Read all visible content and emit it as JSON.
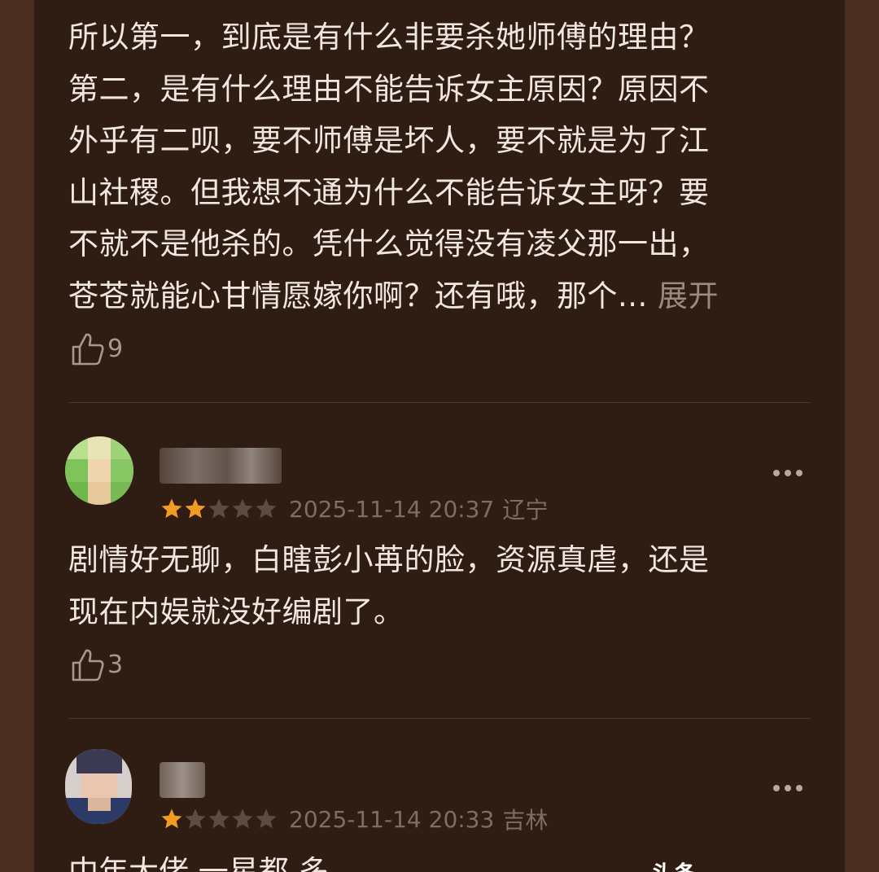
{
  "comments": [
    {
      "lines": [
        "所以第一，到底是有什么非要杀她师傅的理由？",
        "第二，是有什么理由不能告诉女主原因？原因不",
        "外乎有二呗，要不师傅是坏人，要不就是为了江",
        "山社稷。但我想不通为什么不能告诉女主呀？要",
        "不就不是他杀的。凭什么觉得没有凌父那一出，",
        "苍苍就能心甘情愿嫁你啊？还有哦，那个... "
      ],
      "expand_label": "展开",
      "likes": "9"
    },
    {
      "rating": 2,
      "time": "2025-11-14 20:37",
      "location": "辽宁",
      "lines": [
        "剧情好无聊，白瞎彭小苒的脸，资源真虐，还是",
        "现在内娱就没好编剧了。"
      ],
      "likes": "3"
    },
    {
      "rating": 1,
      "time": "2025-11-14 20:33",
      "location": "吉林",
      "partial_text": "中年大佬 一星都 多"
    }
  ],
  "watermark": "头条",
  "colors": {
    "star_active": "#f29b20",
    "star_inactive": "#5e4a40",
    "background": "#2f1c13"
  },
  "icons": {
    "like": "thumbs-up-icon",
    "more": "more-dots-icon",
    "star": "star-icon"
  }
}
